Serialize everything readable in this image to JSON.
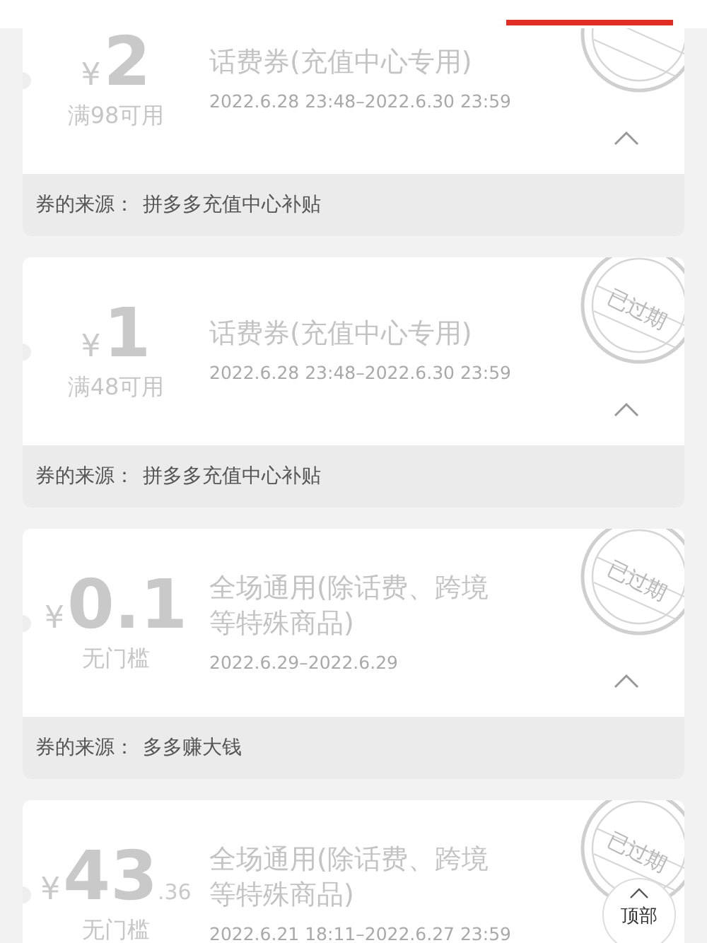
{
  "tabs": [
    {
      "selected": false
    },
    {
      "selected": false
    },
    {
      "selected": true
    }
  ],
  "coupons": [
    {
      "amount": {
        "symbol": "¥",
        "integer": "2"
      },
      "condition": "满98可用",
      "title": "话费券(充值中心专用)",
      "validity": "2022.6.28 23:48–2022.6.30 23:59",
      "expired": true,
      "expanded": true,
      "source": {
        "label": "券的来源：",
        "value": "拼多多充值中心补贴"
      }
    },
    {
      "amount": {
        "symbol": "¥",
        "integer": "1"
      },
      "condition": "满48可用",
      "title": "话费券(充值中心专用)",
      "validity": "2022.6.28 23:48–2022.6.30 23:59",
      "stamp": "已过期",
      "expired": true,
      "expanded": true,
      "source": {
        "label": "券的来源：",
        "value": "拼多多充值中心补贴"
      }
    },
    {
      "amount": {
        "symbol": "¥",
        "integer": "0.1"
      },
      "condition": "无门槛",
      "title": "全场通用(除话费、跨境等特殊商品)",
      "validity": "2022.6.29–2022.6.29",
      "stamp": "已过期",
      "expired": true,
      "expanded": true,
      "source": {
        "label": "券的来源：",
        "value": "多多赚大钱"
      }
    },
    {
      "amount": {
        "symbol": "¥",
        "integer": "43",
        "decimal": ".36"
      },
      "condition": "无门槛",
      "title": "全场通用(除话费、跨境等特殊商品)",
      "validity": "2022.6.21 18:11–2022.6.27 23:59",
      "stamp": "已过期",
      "expired": true
    }
  ],
  "back_to_top": {
    "label": "顶部"
  }
}
